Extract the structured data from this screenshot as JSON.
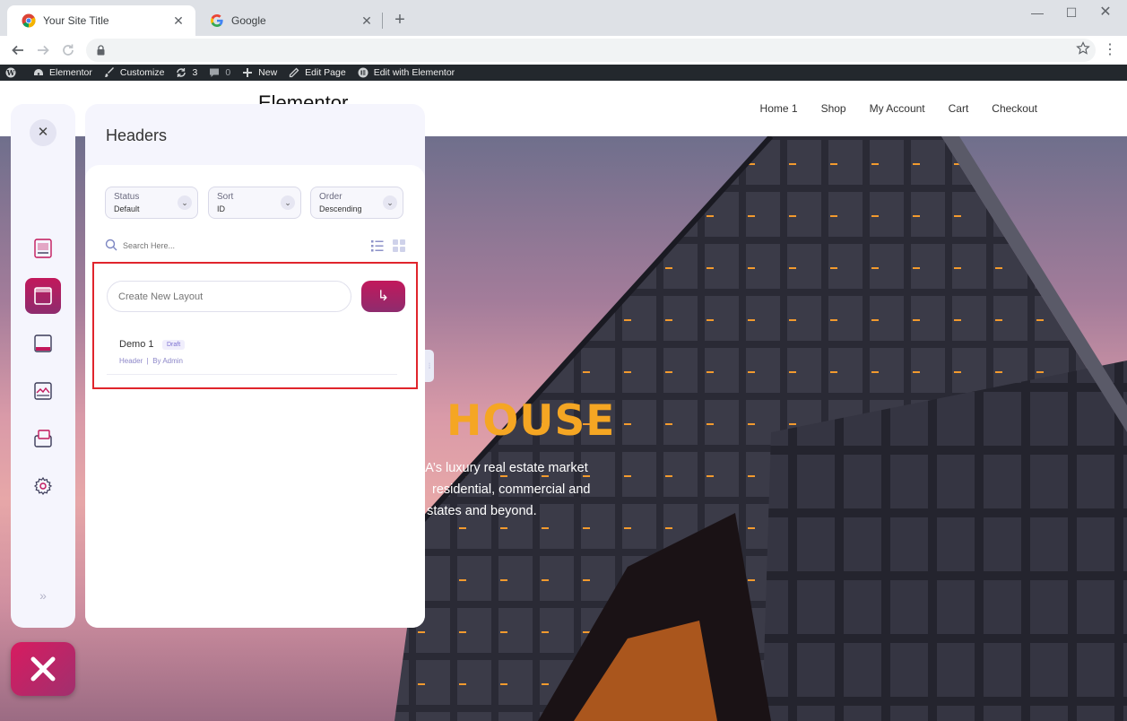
{
  "browser": {
    "tabs": [
      {
        "title": "Your Site Title",
        "active": true
      },
      {
        "title": "Google",
        "active": false
      }
    ],
    "close_glyph": "✕",
    "new_tab_glyph": "+",
    "window_controls": {
      "minimize": "—",
      "maximize": "☐",
      "close": "✕"
    }
  },
  "admin_bar": {
    "items": [
      {
        "icon": "wordpress-icon",
        "label": ""
      },
      {
        "icon": "elementor-dashboard-icon",
        "label": "Elementor"
      },
      {
        "icon": "customize-brush-icon",
        "label": "Customize"
      },
      {
        "icon": "updates-icon",
        "label": "3"
      },
      {
        "icon": "comments-icon",
        "label": "0"
      },
      {
        "icon": "plus-icon",
        "label": "New"
      },
      {
        "icon": "edit-pencil-icon",
        "label": "Edit Page"
      },
      {
        "icon": "elementor-icon",
        "label": "Edit with Elementor"
      }
    ]
  },
  "site": {
    "logo": "Elementor",
    "nav": [
      "Home 1",
      "Shop",
      "My Account",
      "Cart",
      "Checkout"
    ],
    "hero_title": "HOUSE",
    "hero_text": [
      "USA’s luxury real estate market",
      "residential, commercial and",
      "e states and beyond."
    ]
  },
  "sidebar": {
    "close_glyph": "✕",
    "items": [
      {
        "icon": "templates-icon",
        "active": false
      },
      {
        "icon": "header-layout-icon",
        "active": true
      },
      {
        "icon": "footer-layout-icon",
        "active": false
      },
      {
        "icon": "gallery-layout-icon",
        "active": false
      },
      {
        "icon": "popup-layout-icon",
        "active": false
      },
      {
        "icon": "settings-gear-icon",
        "active": false
      }
    ],
    "expand_glyph": "»"
  },
  "panel": {
    "title": "Headers",
    "filters": [
      {
        "label": "Status",
        "value": "Default"
      },
      {
        "label": "Sort",
        "value": "ID"
      },
      {
        "label": "Order",
        "value": "Descending"
      }
    ],
    "search_placeholder": "Search Here...",
    "create_placeholder": "Create New Layout",
    "create_button_glyph": "↳",
    "layouts": [
      {
        "name": "Demo 1",
        "badge": "Draft",
        "meta": "Header  |  By Admin"
      }
    ]
  },
  "colors": {
    "accent": "#c2185b",
    "accent_dark": "#8e2c6e",
    "highlight_border": "#e0252c",
    "hero_title": "#f5a623",
    "admin_bar": "#23282d"
  }
}
